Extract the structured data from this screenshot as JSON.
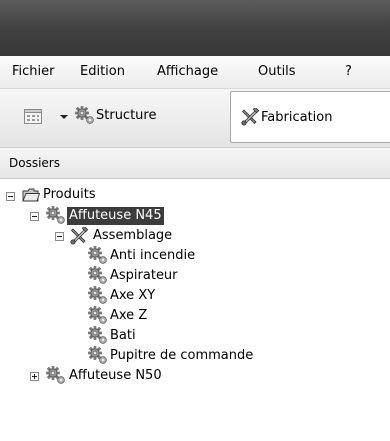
{
  "menu": {
    "items": [
      "Fichier",
      "Edition",
      "Affichage",
      "Outils",
      "?"
    ]
  },
  "toolbar": {
    "view_icon": "grid-view-icon",
    "dropdown_icon": "chevron-down-icon",
    "structure_label": "Structure",
    "structure_icon": "gear-icon",
    "fabrication_label": "Fabrication",
    "fabrication_icon": "tools-icon"
  },
  "panel": {
    "title": "Dossiers"
  },
  "tree": {
    "root": {
      "label": "Produits",
      "icon": "folder-icon",
      "expanded": true
    },
    "product1": {
      "label": "Affuteuse N45",
      "icon": "gear-icon",
      "expanded": true,
      "selected": true
    },
    "assembly": {
      "label": "Assemblage",
      "icon": "tools-icon",
      "expanded": true
    },
    "children": [
      {
        "label": "Anti incendie",
        "icon": "gear-icon"
      },
      {
        "label": "Aspirateur",
        "icon": "gear-icon"
      },
      {
        "label": "Axe XY",
        "icon": "gear-icon"
      },
      {
        "label": "Axe Z",
        "icon": "gear-icon"
      },
      {
        "label": "Bati",
        "icon": "gear-icon"
      },
      {
        "label": "Pupitre de commande",
        "icon": "gear-icon"
      }
    ],
    "product2": {
      "label": "Affuteuse N50",
      "icon": "gear-icon",
      "expanded": false
    }
  },
  "colors": {
    "titlebar": "#434343",
    "selection": "#3c3c3c",
    "selection_text": "#ffffff"
  }
}
